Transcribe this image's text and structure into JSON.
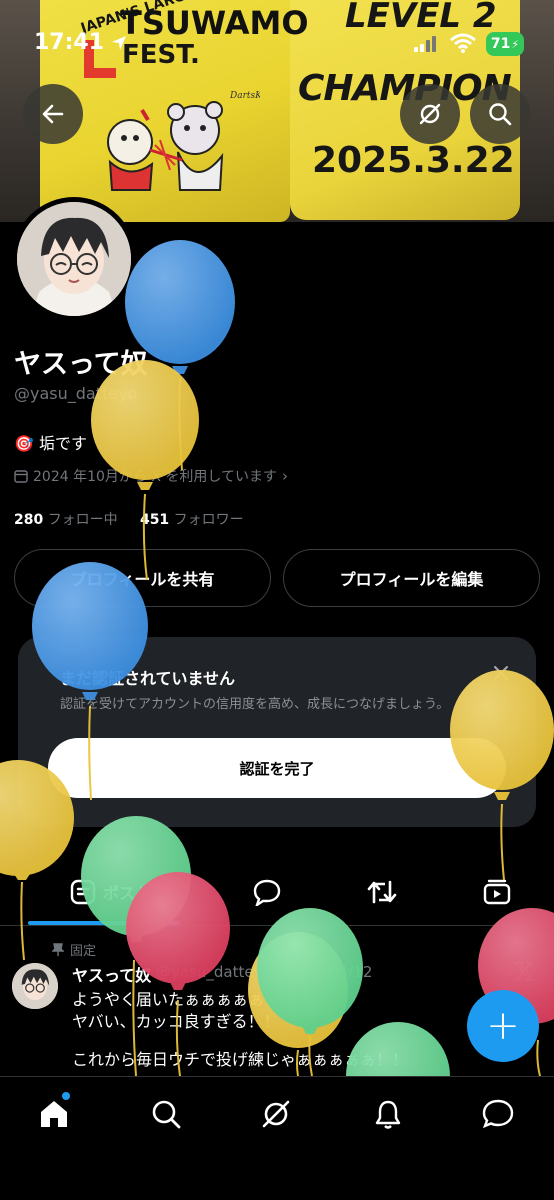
{
  "status": {
    "time": "17:41",
    "battery": "71"
  },
  "banner": {
    "level": "LEVEL 2",
    "champion": "CHAMPION",
    "date": "2025.3.22",
    "japan": "JAPAN'S LARGEST",
    "tsuwa": "TSUWAMO",
    "fest": "FEST.",
    "letter_l": "L",
    "signature": "DartsKeys"
  },
  "profile": {
    "name": "ヤスって奴",
    "handle": "@yasu_datteyo",
    "bio_emoji": "🎯",
    "bio": "垢です",
    "joined": "2024 年10月から X を利用しています",
    "following_count": "280",
    "following_label": "フォロー中",
    "followers_count": "451",
    "followers_label": "フォロワー",
    "share_button": "プロフィールを共有",
    "edit_button": "プロフィールを編集"
  },
  "verify": {
    "title": "まだ認証されていません",
    "description": "認証を受けてアカウントの信用度を高め、成長につなげましょう。",
    "button": "認証を完了"
  },
  "tabs": [
    {
      "label": "ポスト"
    }
  ],
  "post": {
    "pinned_label": "固定",
    "name": "ヤスって奴",
    "meta": "@yasu_datteyo · 2025/04/12",
    "lines": [
      "ようやく届いたぁぁぁぁぁ！",
      "ヤバい、カッコ良すぎる！！",
      "",
      "これから毎日ウチで投げ練じゃぁぁぁぁぁ！！"
    ]
  },
  "fab": {
    "label": "+"
  },
  "colors": {
    "accent": "#1d9bf0",
    "card": "#202327",
    "balloon_blue": "#3d8fe0",
    "balloon_yellow": "#e8c33c",
    "balloon_green": "#5fd08d",
    "balloon_red": "#dd4060"
  },
  "balloons": [
    {
      "color": "blue"
    },
    {
      "color": "yellow"
    },
    {
      "color": "blue"
    },
    {
      "color": "yellow"
    },
    {
      "color": "yellow"
    },
    {
      "color": "green"
    },
    {
      "color": "red"
    },
    {
      "color": "green"
    },
    {
      "color": "yellow"
    },
    {
      "color": "red"
    },
    {
      "color": "green"
    }
  ]
}
